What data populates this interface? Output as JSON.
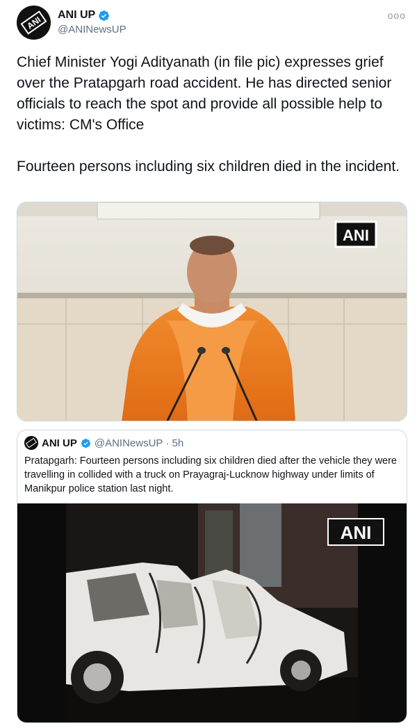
{
  "tweet": {
    "display_name": "ANI UP",
    "handle": "@ANINewsUP",
    "more_label": "ooo",
    "body": "Chief Minister Yogi Adityanath (in file pic) expresses grief over the Pratapgarh road accident. He has directed senior officials to reach the spot and provide all possible help to victims: CM's Office\n\nFourteen persons including six children died in the incident.",
    "media_watermark": "ANI",
    "avatar_logo_text": "ANI"
  },
  "quoted": {
    "display_name": "ANI UP",
    "handle_time": "@ANINewsUP · 5h",
    "body": "Pratapgarh: Fourteen persons including six children died after the vehicle they were travelling in collided with a truck on Prayagraj-Lucknow highway under limits of Manikpur police station last night.",
    "media_watermark": "ANI"
  },
  "colors": {
    "verified": "#1d9bf0",
    "secondary_text": "#5b7083",
    "border": "#cfd9de",
    "saffron": "#e8741e"
  },
  "icons": {
    "verified": "verified-badge-icon",
    "more": "more-horizontal-icon"
  }
}
